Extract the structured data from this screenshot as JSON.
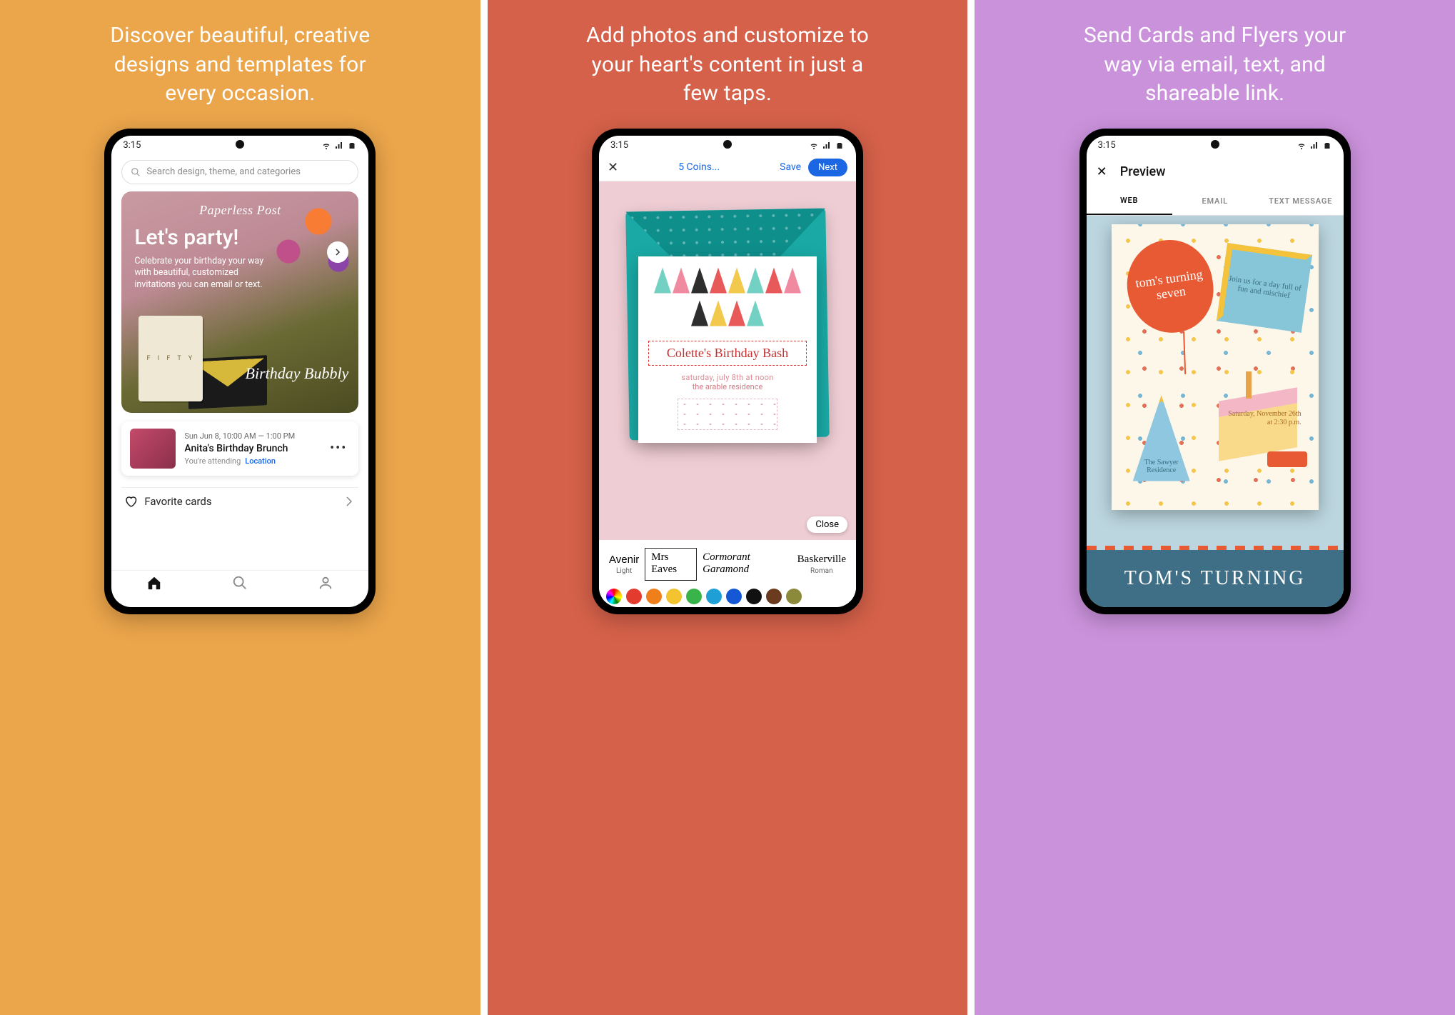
{
  "status_time": "3:15",
  "panel1": {
    "headline": "Discover beautiful, creative designs and templates for every occasion.",
    "search_placeholder": "Search design, theme, and categories",
    "hero": {
      "brand": "Paperless Post",
      "title": "Let's party!",
      "subtitle": "Celebrate your birthday your way with beautiful, customized invitations you can email or text.",
      "bubbly": "Birthday Bubbly",
      "fifty": "F I F T Y"
    },
    "event": {
      "time": "Sun Jun 8, 10:00 AM — 1:00 PM",
      "title": "Anita's Birthday Brunch",
      "attending": "You're attending",
      "location_label": "Location"
    },
    "favorites_label": "Favorite cards"
  },
  "panel2": {
    "headline": "Add photos and customize to your heart's content in just a few taps.",
    "coins": "5 Coins...",
    "save": "Save",
    "next": "Next",
    "card": {
      "title": "Colette's Birthday Bash",
      "sub1": "saturday, july 8th at noon",
      "sub2": "the arable residence"
    },
    "close": "Close",
    "fonts": [
      {
        "name": "Avenir",
        "style": "Light"
      },
      {
        "name": "Mrs Eaves",
        "style": ""
      },
      {
        "name": "Cormorant Garamond",
        "style": ""
      },
      {
        "name": "Baskerville",
        "style": "Roman"
      }
    ],
    "colors": [
      "rainbow",
      "#e33b2e",
      "#ef7f1a",
      "#f4c430",
      "#39b44a",
      "#1ea0d7",
      "#1558d6",
      "#111111",
      "#6b3b1f",
      "#8a8a3a"
    ],
    "hat_colors": [
      "#72d1c3",
      "#f08aa0",
      "#2e2e2e",
      "#e85a5a",
      "#f2c94c",
      "#72d1c3",
      "#e85a5a",
      "#f08aa0",
      "#2e2e2e",
      "#f2c94c",
      "#e85a5a",
      "#72d1c3"
    ]
  },
  "panel3": {
    "headline": "Send Cards and Flyers your way via email, text, and shareable link.",
    "preview_title": "Preview",
    "tabs": [
      "WEB",
      "EMAIL",
      "TEXT MESSAGE"
    ],
    "card": {
      "balloon": "tom's turning seven",
      "gift": "Join us for a day full of fun and mischief",
      "hat": "The Sawyer Residence",
      "cake_date": "Saturday, November 26th",
      "cake_time": "at 2:30 p.m.",
      "strip": "TOM'S TURNING"
    }
  }
}
